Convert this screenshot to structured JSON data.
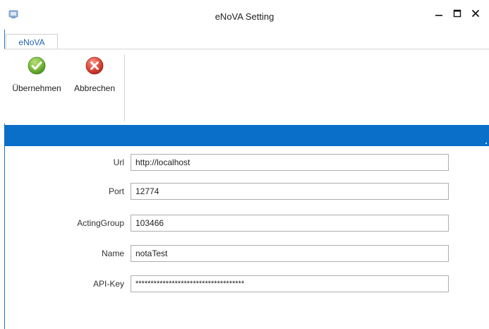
{
  "window": {
    "title": "eNoVA Setting",
    "icon": "app-window-icon",
    "controls": [
      "minimize-icon",
      "maximize-icon",
      "close-icon"
    ]
  },
  "ribbon": {
    "tab_label": "eNoVA",
    "apply": {
      "label": "Übernehmen",
      "icon": "check-circle-icon",
      "color": "#6aa933"
    },
    "cancel": {
      "label": "Abbrechen",
      "icon": "x-circle-icon",
      "color": "#d8423b"
    }
  },
  "colors": {
    "accent_bar": "#0a6fc8",
    "tab_text": "#1f63b3"
  },
  "form": {
    "url": {
      "label": "Url",
      "value": "http://localhost"
    },
    "port": {
      "label": "Port",
      "value": "12774"
    },
    "acting_group": {
      "label": "ActingGroup",
      "value": "103466"
    },
    "name": {
      "label": "Name",
      "value": "notaTest"
    },
    "api_key": {
      "label": "API-Key",
      "value": "************************************"
    }
  }
}
